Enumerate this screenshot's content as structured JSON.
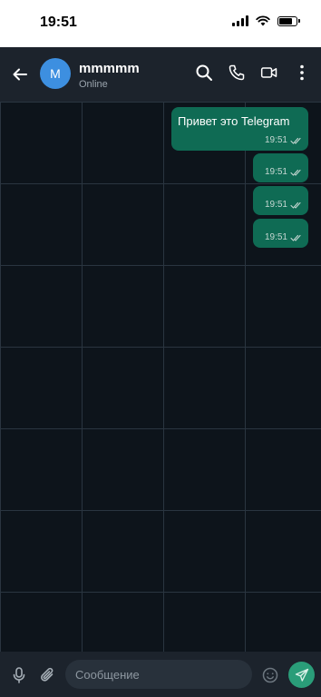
{
  "status_bar": {
    "time": "19:51",
    "battery_level": 0.8
  },
  "header": {
    "avatar_letter": "M",
    "contact_name": "mmmmm",
    "contact_status": "Online",
    "icons": [
      "back-arrow-icon",
      "search-icon",
      "phone-icon",
      "video-camera-icon",
      "more-vertical-icon"
    ]
  },
  "messages": [
    {
      "text": "Привет это Telegram",
      "time": "19:51",
      "status": "read"
    },
    {
      "text": "",
      "time": "19:51",
      "status": "read"
    },
    {
      "text": "",
      "time": "19:51",
      "status": "read"
    },
    {
      "text": "",
      "time": "19:51",
      "status": "read"
    }
  ],
  "input_bar": {
    "placeholder": "Сообщение",
    "value": "",
    "icons": [
      "microphone-icon",
      "paperclip-icon",
      "emoji-icon",
      "send-icon"
    ]
  },
  "colors": {
    "header_bg": "#1c232c",
    "chat_bg": "#0d141b",
    "bubble_out": "#0f6b54",
    "send_button": "#2a9d79",
    "avatar": "#3d8fe0"
  }
}
